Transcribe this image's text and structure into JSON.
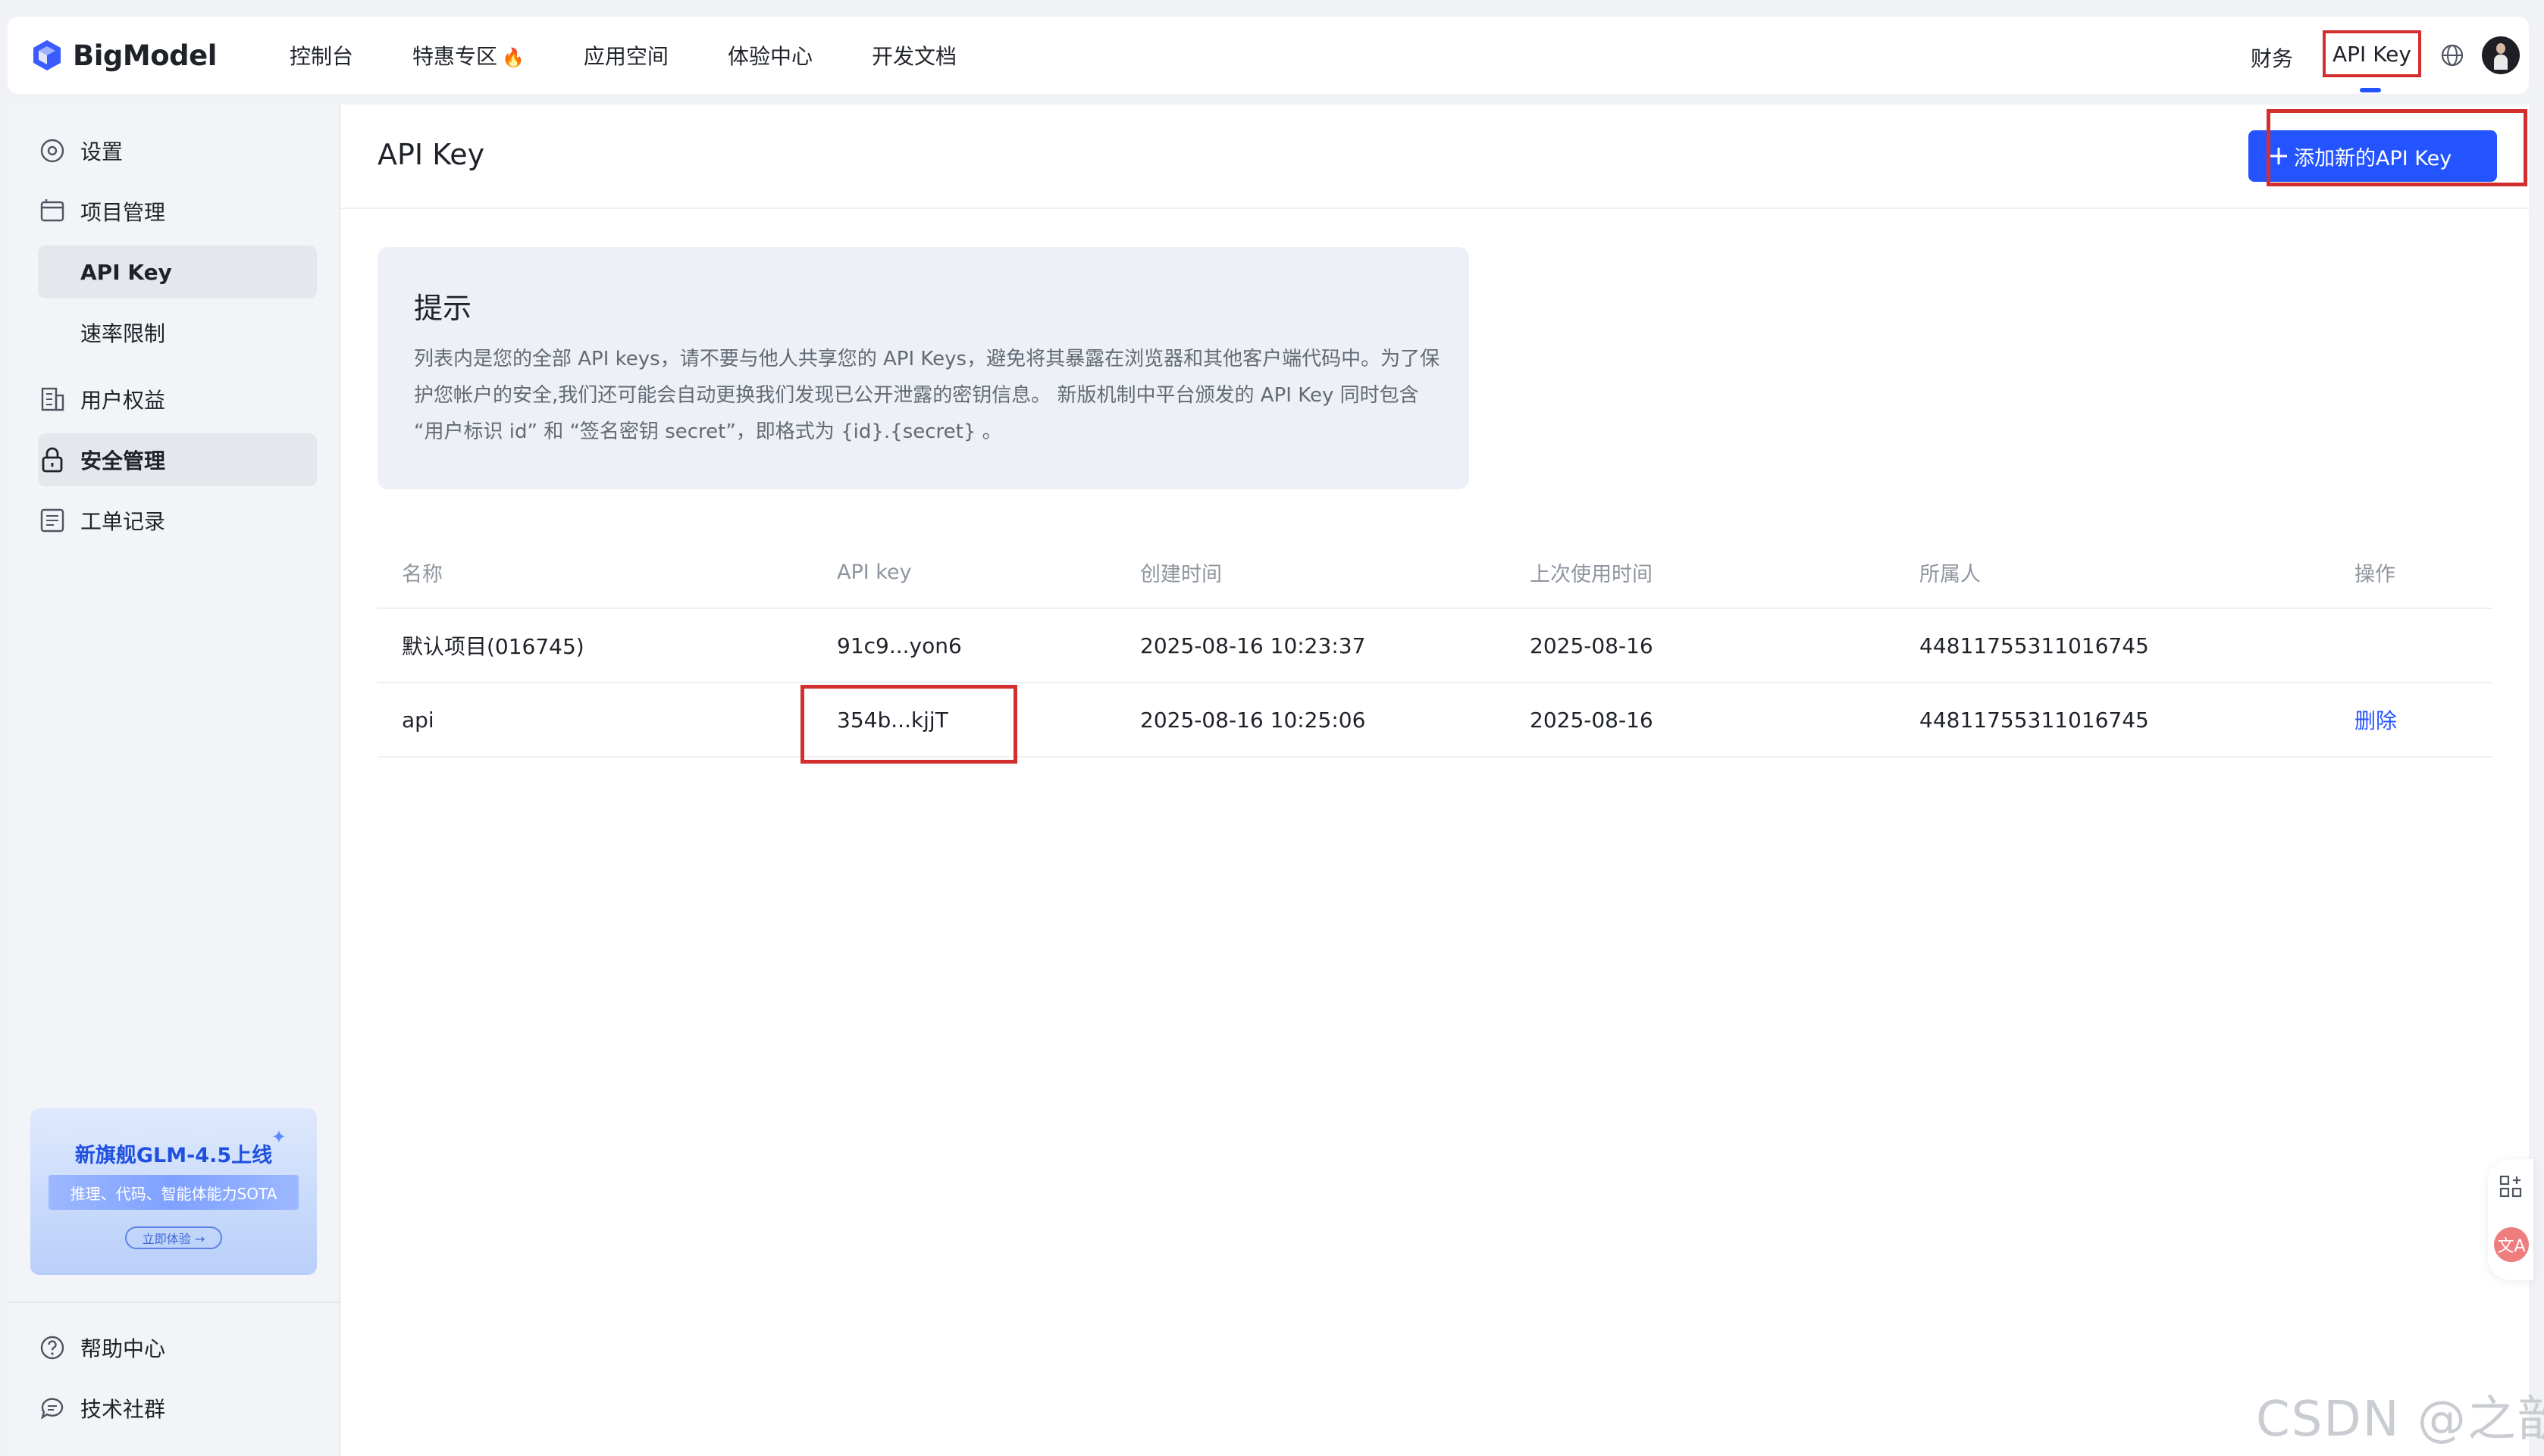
{
  "app": {
    "brand": "BigModel",
    "accent_color": "#2454ff",
    "alert_color": "#d32f2f"
  },
  "topnav": {
    "items": [
      {
        "label": "控制台"
      },
      {
        "label": "特惠专区",
        "badge_icon": "fire-icon"
      },
      {
        "label": "应用空间"
      },
      {
        "label": "体验中心"
      },
      {
        "label": "开发文档"
      }
    ],
    "finance_label": "财务",
    "apikey_label": "API Key",
    "globe_icon": "globe-icon",
    "avatar_icon": "avatar"
  },
  "sidebar": {
    "items": [
      {
        "label": "设置",
        "icon": "settings-icon"
      },
      {
        "label": "项目管理",
        "icon": "folder-icon"
      },
      {
        "label": "API Key",
        "sub": true,
        "active": true
      },
      {
        "label": "速率限制",
        "sub": true
      },
      {
        "label": "用户权益",
        "icon": "building-icon"
      },
      {
        "label": "安全管理",
        "icon": "lock-icon",
        "active": true
      },
      {
        "label": "工单记录",
        "icon": "ticket-icon"
      }
    ],
    "promo": {
      "title": "新旗舰GLM-4.5上线",
      "subtitle": "推理、代码、智能体能力SOTA",
      "cta": "立即体验 →"
    },
    "footer_items": [
      {
        "label": "帮助中心",
        "icon": "help-icon"
      },
      {
        "label": "技术社群",
        "icon": "chat-icon"
      }
    ]
  },
  "main": {
    "title": "API Key",
    "add_button": "添加新的API Key",
    "tip": {
      "title": "提示",
      "body": "列表内是您的全部 API keys，请不要与他人共享您的 API Keys，避免将其暴露在浏览器和其他客户端代码中。为了保护您帐户的安全,我们还可能会自动更换我们发现已公开泄露的密钥信息。 新版机制中平台颁发的 API Key 同时包含 “用户标识 id” 和 “签名密钥 secret”，即格式为 {id}.{secret} 。"
    },
    "table": {
      "columns": [
        "名称",
        "API key",
        "创建时间",
        "上次使用时间",
        "所属人",
        "操作"
      ],
      "rows": [
        {
          "name": "默认项目(016745)",
          "key": "91c9...yon6",
          "created": "2025-08-16 10:23:37",
          "last_used": "2025-08-16",
          "owner": "44811755311016745",
          "action": ""
        },
        {
          "name": "api",
          "key": "354b...kjjT",
          "created": "2025-08-16 10:25:06",
          "last_used": "2025-08-16",
          "owner": "44811755311016745",
          "action": "删除"
        }
      ]
    }
  },
  "float_tools": {
    "grid_icon": "add-widget-icon",
    "translate_icon": "translate-icon",
    "translate_label": "文A"
  },
  "watermark": "CSDN @之歆"
}
